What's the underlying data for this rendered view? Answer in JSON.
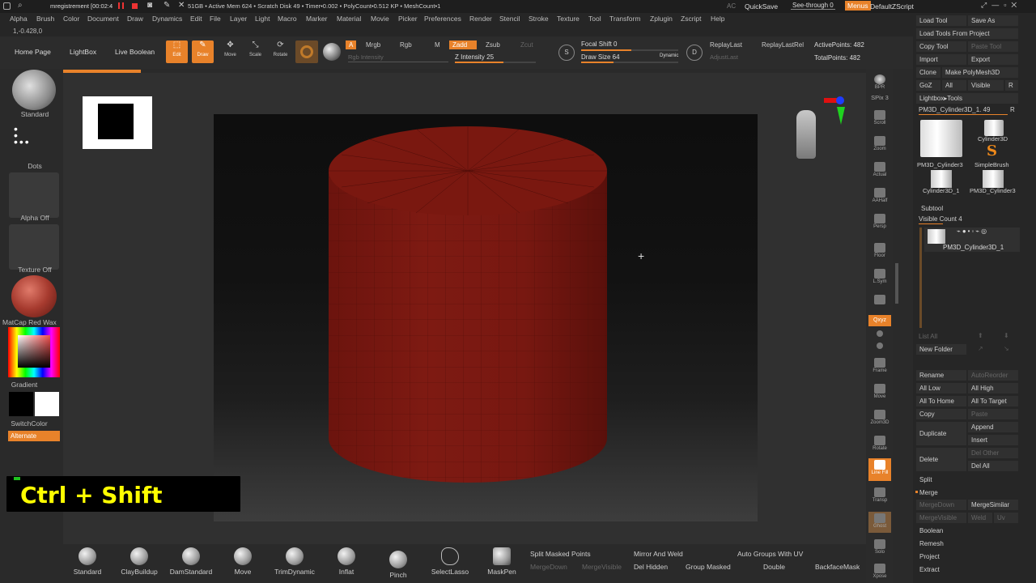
{
  "titlebar": {
    "recorder": "mregistrement [00:02:4",
    "stats": "51GB • Active Mem 624 • Scratch Disk 49 • Timer•0.002 • PolyCount•0.512 KP • MeshCount•1",
    "ac": "AC",
    "quicksave": "QuickSave",
    "seethrough": "See-through  0",
    "menus": "Menus",
    "script": "DefaultZScript"
  },
  "menu": [
    "Alpha",
    "Brush",
    "Color",
    "Document",
    "Draw",
    "Dynamics",
    "Edit",
    "File",
    "Layer",
    "Light",
    "Macro",
    "Marker",
    "Material",
    "Movie",
    "Picker",
    "Preferences",
    "Render",
    "Stencil",
    "Stroke",
    "Texture",
    "Tool",
    "Transform",
    "Zplugin",
    "Zscript",
    "Help"
  ],
  "coords": "1,-0.428,0",
  "toolbar": {
    "home": "Home Page",
    "lightbox": "LightBox",
    "liveboolean": "Live Boolean",
    "edit": "Edit",
    "draw": "Draw",
    "move": "Move",
    "scale": "Scale",
    "rotate": "Rotate",
    "a": "A",
    "mrgb": "Mrgb",
    "rgb": "Rgb",
    "m": "M",
    "zadd": "Zadd",
    "zsub": "Zsub",
    "zcut": "Zcut",
    "rgb_intensity": "Rgb Intensity",
    "z_intensity": "Z Intensity 25",
    "focal_shift": "Focal Shift 0",
    "draw_size": "Draw Size 64",
    "dynamic": "Dynamic",
    "replaylast": "ReplayLast",
    "replaylastrel": "ReplayLastRel",
    "adjustlast": "AdjustLast",
    "activepoints": "ActivePoints: 482",
    "totalpoints": "TotalPoints: 482"
  },
  "leftshelf": {
    "standard": "Standard",
    "dots": "Dots",
    "alpha": "Alpha Off",
    "texture": "Texture Off",
    "matcap": "MatCap Red Wax",
    "gradient": "Gradient",
    "switchcolor": "SwitchColor",
    "alternate": "Alternate"
  },
  "rightshelf": [
    "BPR",
    "SPix 3",
    "Scroll",
    "Zoom",
    "Actual",
    "AAHalf",
    "Persp",
    "Floor",
    "L.Sym",
    "",
    "Qxyz",
    "",
    "",
    "Frame",
    "Move",
    "Zoom3D",
    "Rotate",
    "Line Fill",
    "Transp",
    "Ghost",
    "Solo",
    "Xpose"
  ],
  "toolpanel": {
    "load_tool": "Load Tool",
    "save_as": "Save As",
    "load_from_project": "Load Tools From Project",
    "copy_tool": "Copy Tool",
    "paste_tool": "Paste Tool",
    "import": "Import",
    "export": "Export",
    "clone": "Clone",
    "make_polymesh": "Make PolyMesh3D",
    "goz": "GoZ",
    "all": "All",
    "visible": "Visible",
    "r": "R",
    "lightbox_tools": "Lightbox▸Tools",
    "current_tool": "PM3D_Cylinder3D_1. 49",
    "r2": "R",
    "thumbs": [
      "PM3D_Cylinder3",
      "Cylinder3D",
      "SimpleBrush",
      "Cylinder3D_1",
      "PM3D_Cylinder3"
    ],
    "subtool": "Subtool",
    "visible_count": "Visible Count 4",
    "subtool_name": "PM3D_Cylinder3D_1",
    "list_all": "List All",
    "new_folder": "New Folder",
    "rename": "Rename",
    "autoreorder": "AutoReorder",
    "all_low": "All Low",
    "all_high": "All High",
    "all_to_home": "All To Home",
    "all_to_target": "All To Target",
    "copy": "Copy",
    "paste": "Paste",
    "append": "Append",
    "duplicate": "Duplicate",
    "insert": "Insert",
    "del_other": "Del Other",
    "delete": "Delete",
    "del_all": "Del All",
    "split": "Split",
    "merge": "Merge",
    "merge_down": "MergeDown",
    "merge_similar": "MergeSimilar",
    "merge_visible": "MergeVisible",
    "weld": "Weld",
    "uv": "Uv",
    "boolean": "Boolean",
    "remesh": "Remesh",
    "project": "Project",
    "extract": "Extract"
  },
  "bottombrushes": [
    "Standard",
    "ClayBuildup",
    "DamStandard",
    "Move",
    "TrimDynamic",
    "Inflat",
    "Pinch",
    "SelectLasso",
    "MaskPen"
  ],
  "bottomoptions": {
    "split_masked": "Split Masked Points",
    "mirror_weld": "Mirror And Weld",
    "auto_groups_uv": "Auto Groups With UV",
    "merge_down": "MergeDown",
    "merge_visible": "MergeVisible",
    "del_hidden": "Del Hidden",
    "group_masked": "Group Masked",
    "double": "Double",
    "backface_mask": "BackfaceMask"
  },
  "shortcut": "Ctrl + Shift",
  "colors": {
    "accent": "#e8822a",
    "mesh": "#7a1a12",
    "shortcut_text": "#ffff00"
  }
}
